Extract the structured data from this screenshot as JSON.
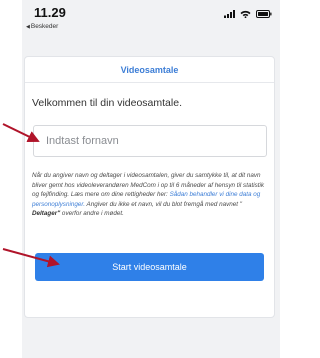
{
  "status_bar": {
    "time": "11.29",
    "back_label": "Beskeder"
  },
  "card": {
    "title": "Videosamtale",
    "welcome": "Velkommen til din videosamtale.",
    "name_input": {
      "placeholder": "Indtast fornavn",
      "value": ""
    },
    "info": {
      "part1": "Når du angiver navn og deltager i videosamtalen, giver du samtykke til, at dit navn bliver gemt hos videoleverandøren MedCom i op til 6 måneder af hensyn til statistik og fejlfinding. Læs mere om dine rettigheder her: ",
      "link": "Sådan behandler vi dine data og personoplysninger.",
      "part2": " Angiver du ikke et navn, vil du blot fremgå med navnet \"",
      "bold": " Deltager\"",
      "part3": " overfor andre i mødet."
    },
    "start_button": "Start videosamtale"
  },
  "colors": {
    "accent": "#2f80e8",
    "title": "#3d7ed6",
    "annotation_arrow": "#b0142a"
  },
  "icons": [
    "signal-icon",
    "wifi-icon",
    "battery-icon",
    "back-arrow-icon"
  ]
}
